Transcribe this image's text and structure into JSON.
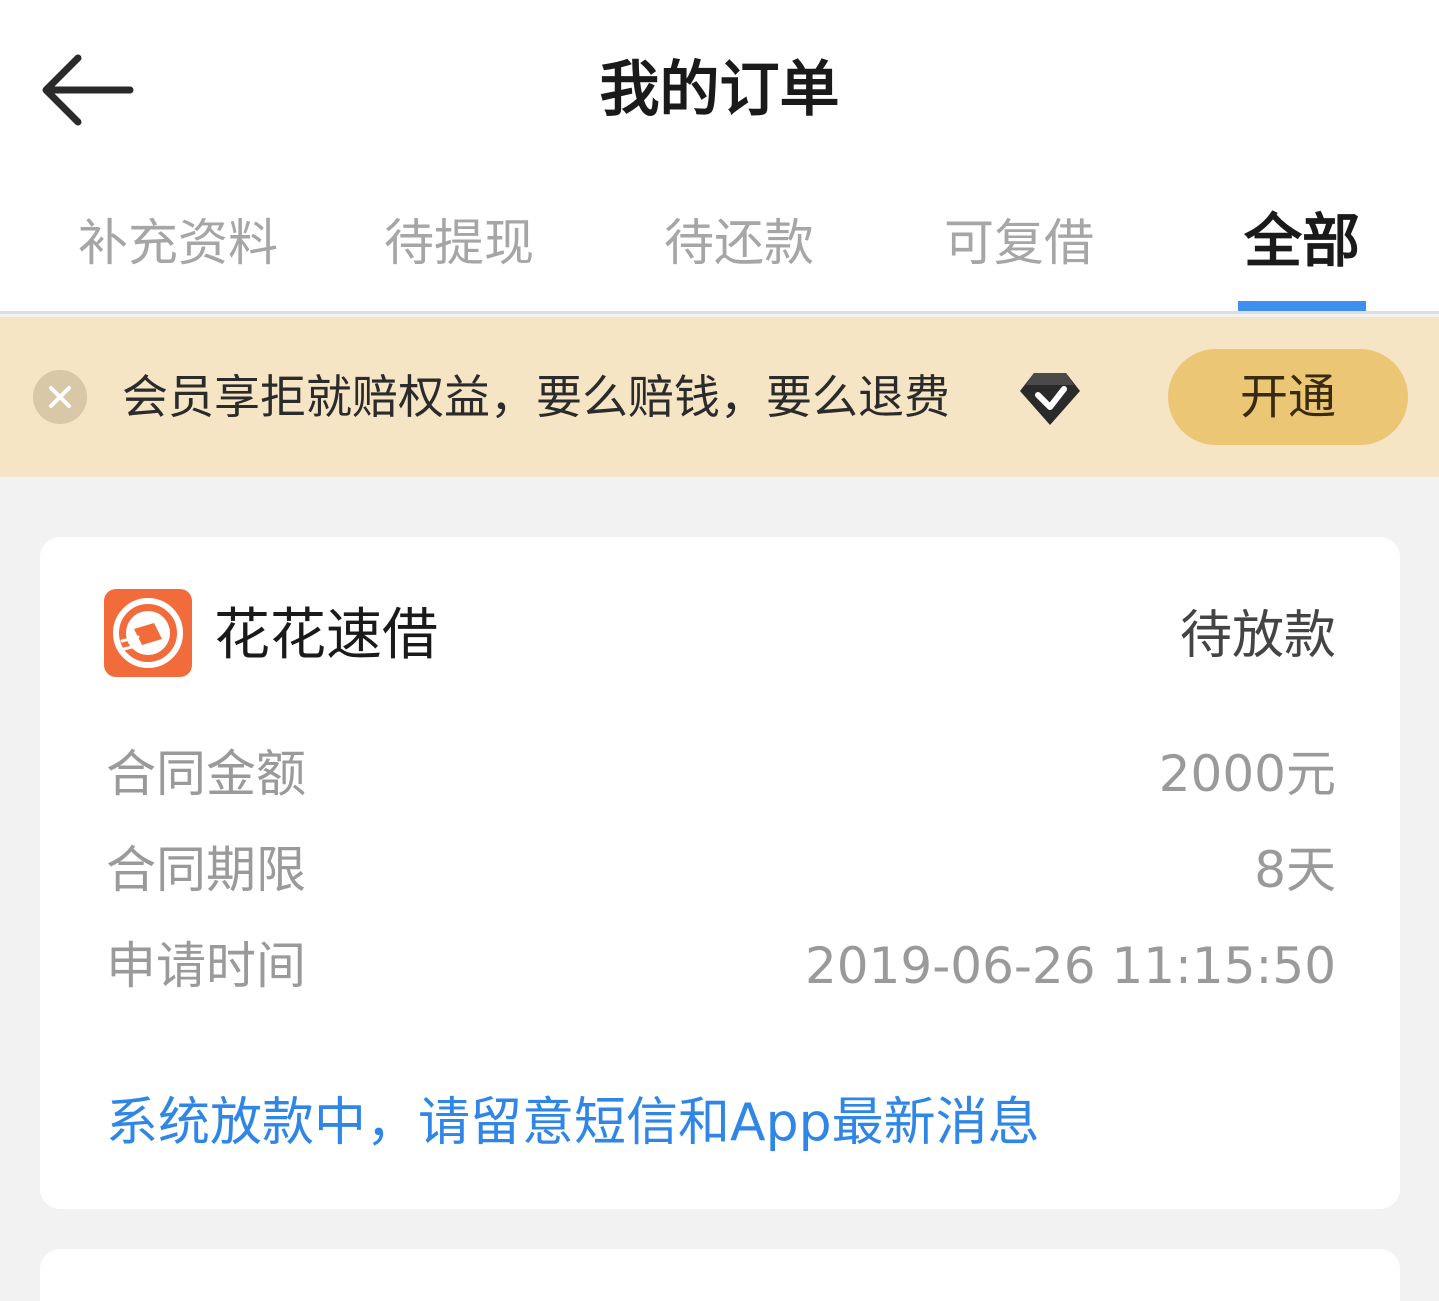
{
  "header": {
    "title": "我的订单",
    "back_icon": "arrow-left-icon"
  },
  "tabs": [
    {
      "label": "补充资料",
      "active": false
    },
    {
      "label": "待提现",
      "active": false
    },
    {
      "label": "待还款",
      "active": false
    },
    {
      "label": "可复借",
      "active": false
    },
    {
      "label": "全部",
      "active": true
    }
  ],
  "promo": {
    "text": "会员享拒就赔权益，要么赔钱，要么退费",
    "button_label": "开通",
    "close_icon": "close-icon",
    "badge_icon": "diamond-icon"
  },
  "orders": [
    {
      "app_name": "花花速借",
      "status": "待放款",
      "rows": [
        {
          "label": "合同金额",
          "value": "2000元"
        },
        {
          "label": "合同期限",
          "value": "8天"
        },
        {
          "label": "申请时间",
          "value": "2019-06-26 11:15:50"
        }
      ],
      "notice": "系统放款中，请留意短信和App最新消息"
    }
  ],
  "colors": {
    "accent": "#3f8ff0",
    "promo_bg": "#f5e5c5",
    "promo_button": "#ebc674",
    "notice": "#2f86e6",
    "logo": "#f26b3a"
  }
}
